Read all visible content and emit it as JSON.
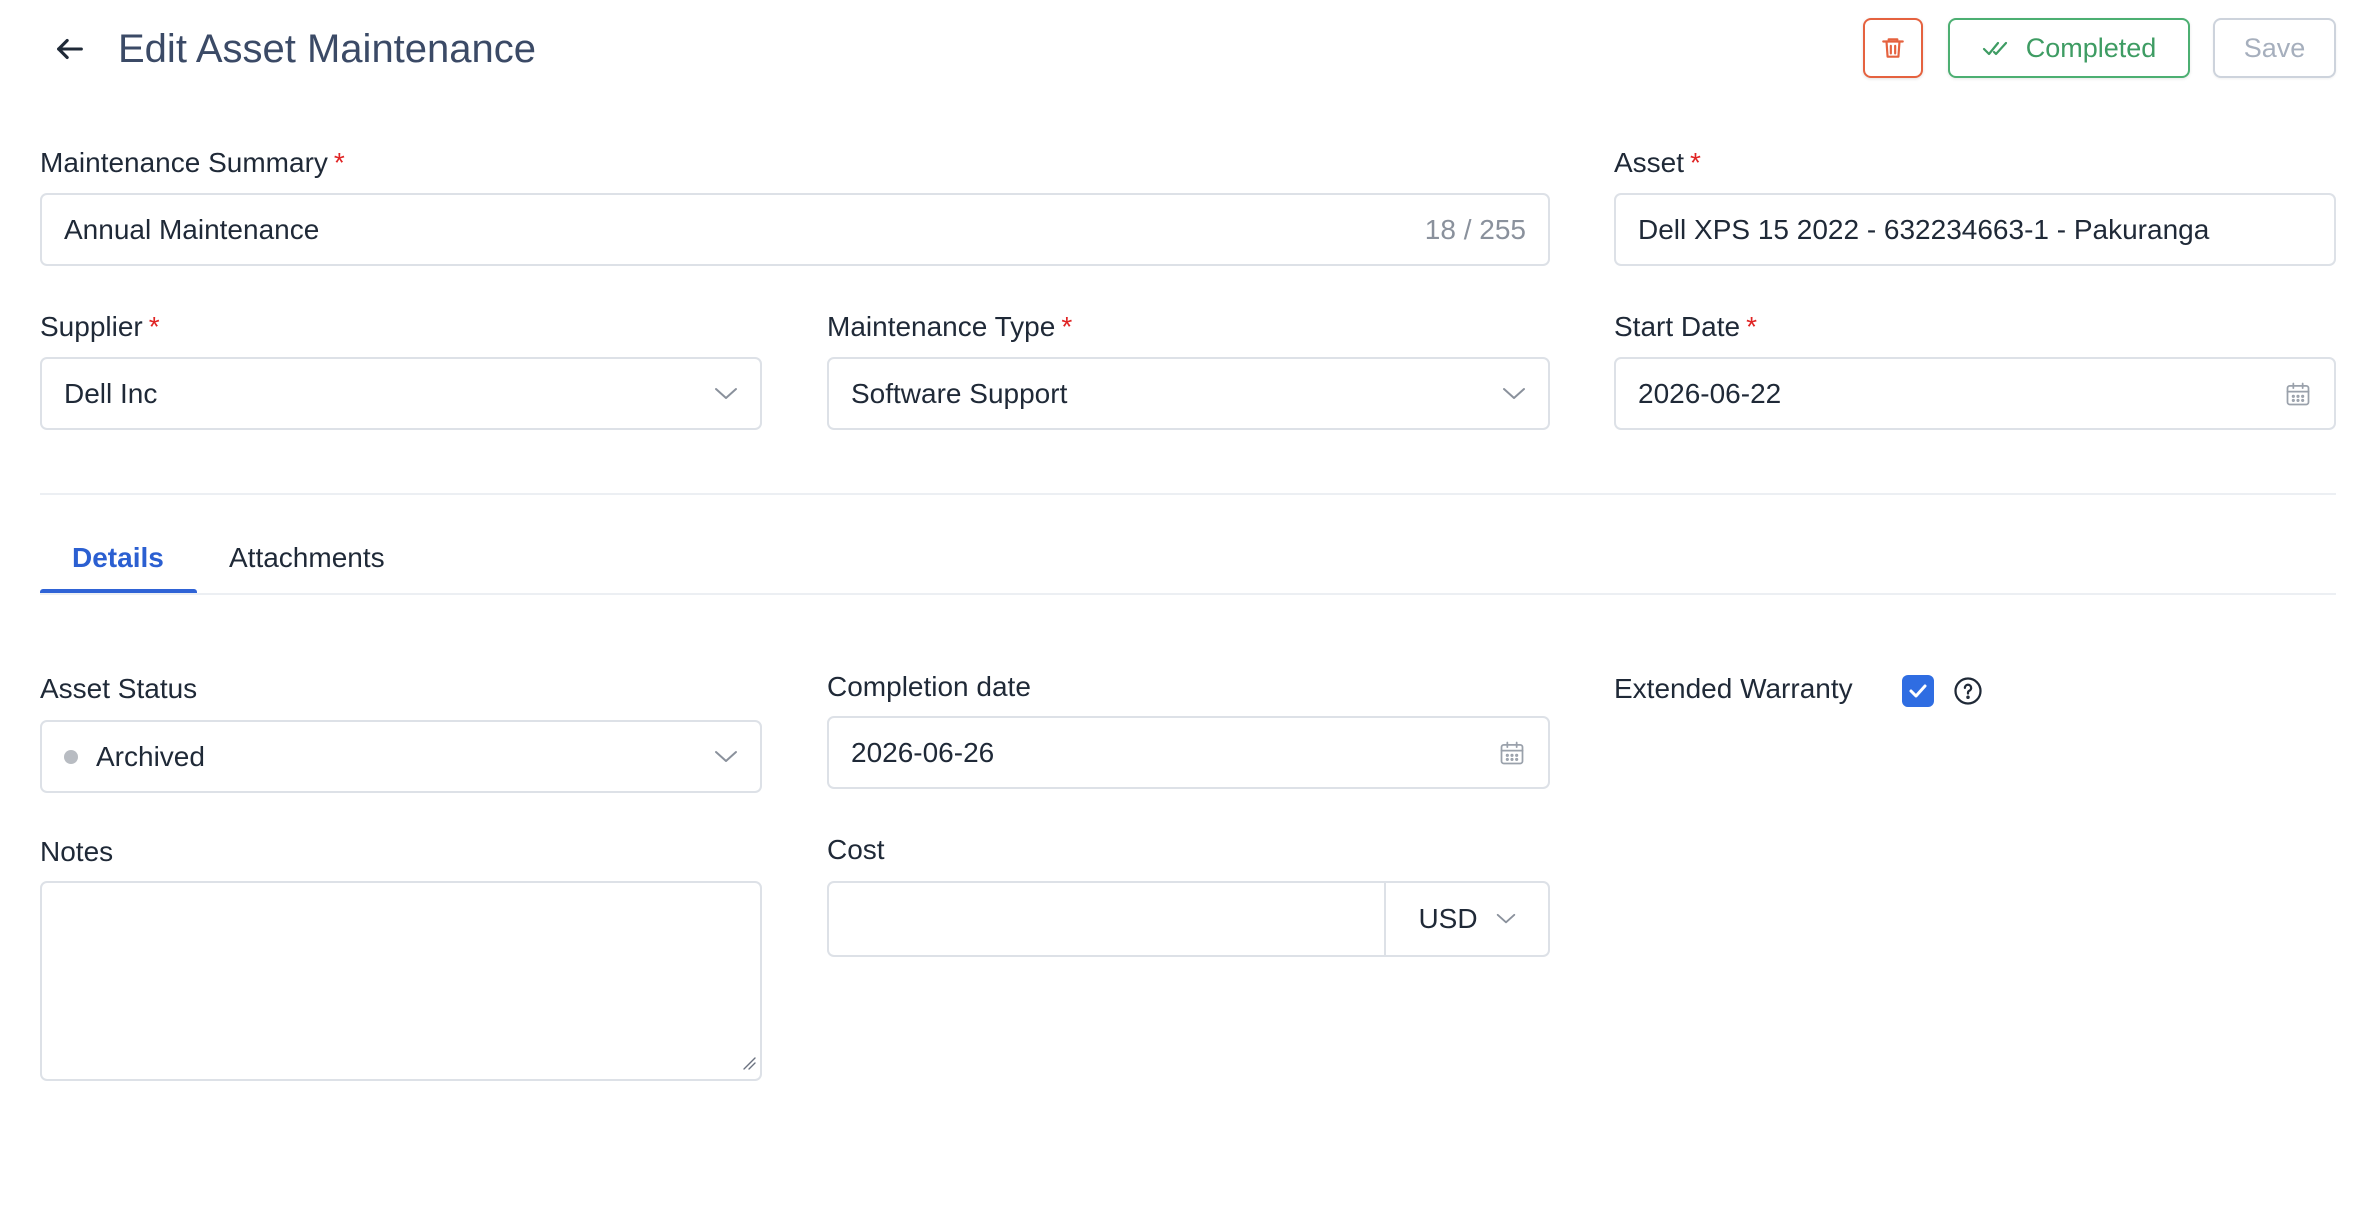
{
  "header": {
    "title": "Edit Asset Maintenance",
    "completed_label": "Completed",
    "save_label": "Save"
  },
  "form": {
    "summary": {
      "label": "Maintenance Summary",
      "required": "*",
      "value": "Annual Maintenance",
      "counter": "18 / 255"
    },
    "asset": {
      "label": "Asset",
      "required": "*",
      "value": "Dell XPS 15 2022 - 632234663-1 - Pakuranga"
    },
    "supplier": {
      "label": "Supplier",
      "required": "*",
      "value": "Dell Inc"
    },
    "maintenance_type": {
      "label": "Maintenance Type",
      "required": "*",
      "value": "Software Support"
    },
    "start_date": {
      "label": "Start Date",
      "required": "*",
      "value": "2026-06-22"
    }
  },
  "tabs": [
    {
      "label": "Details",
      "active": true
    },
    {
      "label": "Attachments",
      "active": false
    }
  ],
  "details": {
    "asset_status": {
      "label": "Asset Status",
      "value": "Archived",
      "dot_color": "#b8bcc2"
    },
    "completion_date": {
      "label": "Completion date",
      "value": "2026-06-26"
    },
    "extended_warranty": {
      "label": "Extended Warranty",
      "checked": true
    },
    "notes": {
      "label": "Notes",
      "value": ""
    },
    "cost": {
      "label": "Cost",
      "value": "",
      "currency": "USD"
    }
  },
  "colors": {
    "accent": "#2f63d6",
    "success": "#4caf72",
    "danger": "#e5623f",
    "required": "#e02424"
  },
  "icons": {
    "back": "arrow-left-icon",
    "delete": "trash-icon",
    "completed": "double-check-icon",
    "dropdown": "chevron-down-icon",
    "date": "calendar-icon",
    "help": "question-circle-icon"
  }
}
